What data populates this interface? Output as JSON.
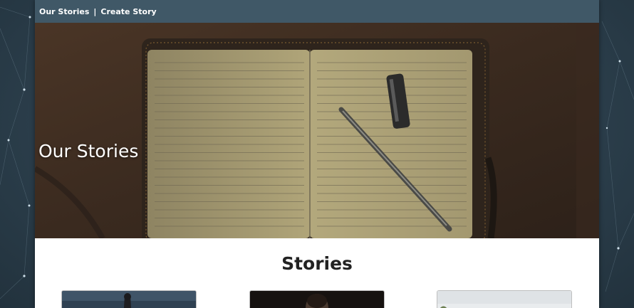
{
  "nav": {
    "links": [
      {
        "label": "Our Stories"
      },
      {
        "label": "Create Story"
      }
    ],
    "separator": "|"
  },
  "hero": {
    "title": "Our Stories",
    "image": "notebook-and-pen-photo"
  },
  "stories": {
    "heading": "Stories",
    "cards": [
      {
        "image": "story-thumbnail-1"
      },
      {
        "image": "story-thumbnail-2"
      },
      {
        "image": "story-thumbnail-3"
      }
    ]
  },
  "colors": {
    "nav_bg": "#405867",
    "page_bg": "#ffffff",
    "backdrop": "#2b3e4b"
  }
}
